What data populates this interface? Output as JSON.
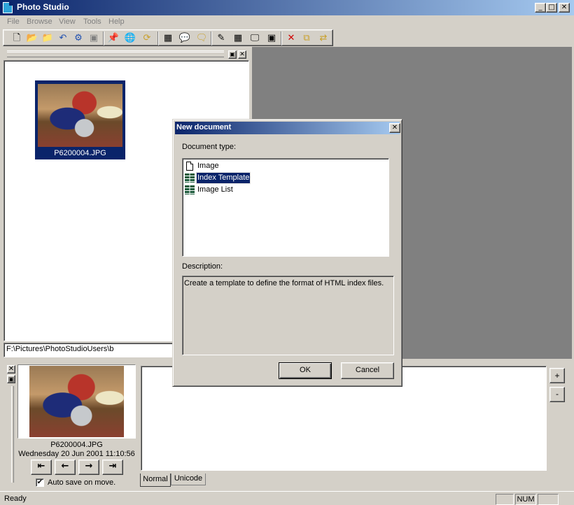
{
  "window": {
    "title": "Photo Studio",
    "controls": {
      "minimize": "_",
      "maximize": "□",
      "close": "✕"
    }
  },
  "menu": [
    "File",
    "Browse",
    "View",
    "Tools",
    "Help"
  ],
  "toolbar": {
    "icons": [
      "new-icon",
      "open-icon",
      "open-folder-icon",
      "undo-icon",
      "settings-icon",
      "save-icon",
      "pushpin-icon",
      "globe-icon",
      "refresh-icon",
      "thumbnails-icon",
      "comment-icon",
      "comments-icon",
      "pencil-icon",
      "grid-icon",
      "slideshow-icon",
      "fullscreen-icon",
      "delete-icon",
      "copy-to-icon",
      "move-to-icon"
    ]
  },
  "browser": {
    "thumbnail_label": "P6200004.JPG",
    "path": "F:\\Pictures\\PhotoStudioUsers\\b"
  },
  "preview": {
    "filename": "P6200004.JPG",
    "date": "Wednesday 20 Jun 2001 11:10:56",
    "autosave_label": "Auto save on move.",
    "autosave_checked": "✔"
  },
  "editor": {
    "tabs": [
      "Normal",
      "Unicode"
    ],
    "plus": "+",
    "minus": "-"
  },
  "status": {
    "text": "Ready",
    "num": "NUM"
  },
  "dialog": {
    "title": "New document",
    "close": "✕",
    "doctype_label": "Document type:",
    "doctypes": [
      "Image",
      "Index Template",
      "Image List"
    ],
    "selected": "Index Template",
    "description_label": "Description:",
    "description": "Create a template to define the format of HTML index files.",
    "ok": "OK",
    "cancel": "Cancel"
  }
}
